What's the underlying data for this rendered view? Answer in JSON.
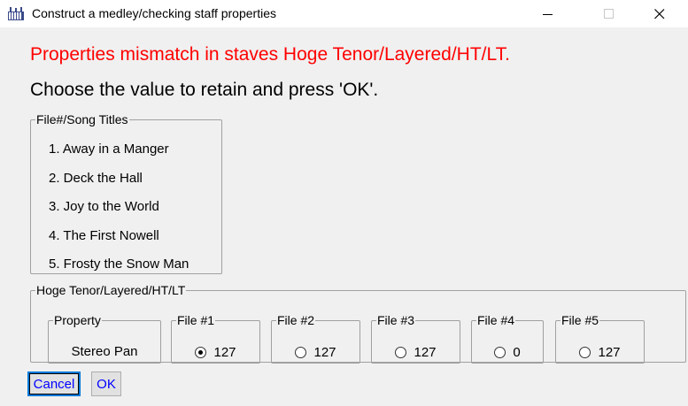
{
  "window": {
    "title": "Construct a medley/checking staff properties",
    "icon": "music-notes-icon",
    "controls": [
      "minimize-icon",
      "maximize-icon",
      "close-icon"
    ]
  },
  "message": {
    "mismatch": "Properties mismatch in staves Hoge Tenor/Layered/HT/LT.",
    "instruction": "Choose the value to retain and press 'OK'.",
    "mismatch_color": "#ff0000"
  },
  "songs": {
    "legend": "File#/Song Titles",
    "items": [
      "1. Away in a Manger",
      "2. Deck the Hall",
      "3. Joy to the World",
      "4. The First Nowell",
      "5. Frosty the Snow Man"
    ]
  },
  "staff": {
    "legend": "Hoge Tenor/Layered/HT/LT",
    "property_legend": "Property",
    "property_value": "Stereo Pan",
    "files": [
      {
        "label": "File #1",
        "value": "127",
        "selected": true
      },
      {
        "label": "File #2",
        "value": "127",
        "selected": false
      },
      {
        "label": "File #3",
        "value": "127",
        "selected": false
      },
      {
        "label": "File #4",
        "value": "0",
        "selected": false
      },
      {
        "label": "File #5",
        "value": "127",
        "selected": false
      }
    ]
  },
  "buttons": {
    "cancel": "Cancel",
    "ok": "OK",
    "text_color": "#0000ff"
  }
}
